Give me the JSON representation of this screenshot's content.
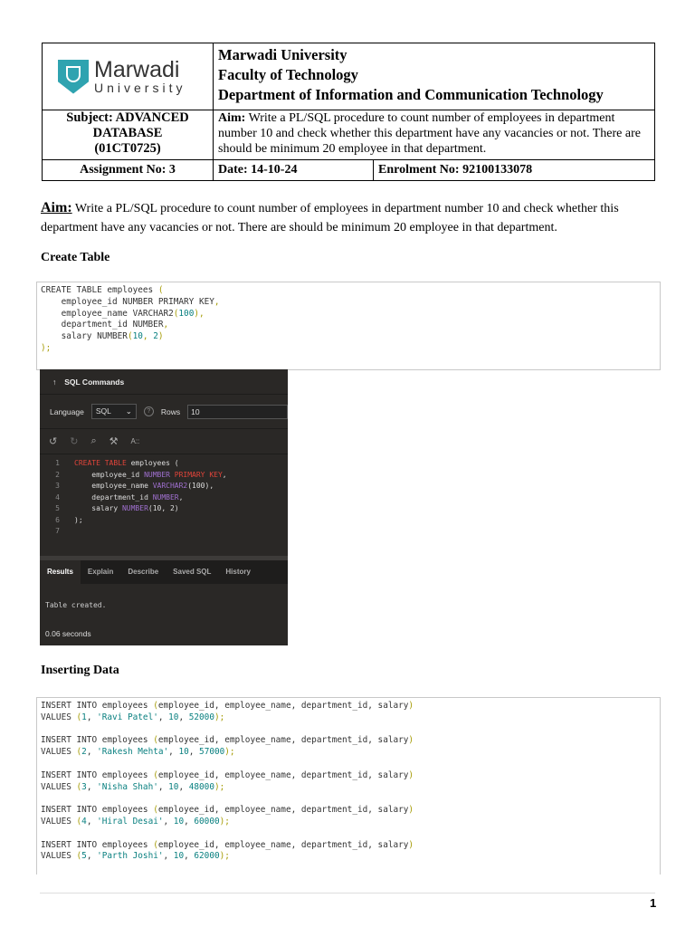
{
  "header": {
    "logo_line1": "Marwadi",
    "logo_line2": "University",
    "university": "Marwadi University",
    "faculty": "Faculty of Technology",
    "department": "Department of Information and Communication Technology",
    "subject_label": "Subject: ADVANCED DATABASE (01CT0725)",
    "aim_label": "Aim:",
    "aim_text": " Write a PL/SQL procedure  to count number of employees in department number 10 and check whether this department have any vacancies or not. There are should be minimum 20 employee in that department.",
    "assignment": "Assignment No: 3",
    "date": "Date: 14-10-24",
    "enrolment": "Enrolment No: 92100133078"
  },
  "aim": {
    "label": "Aim:",
    "text": " Write a PL/SQL procedure  to count number of employees in department number 10 and check whether this department have any vacancies or not. There are should be minimum 20 employee in that department."
  },
  "create_heading": "Create Table",
  "create_code": [
    [
      [
        "CREATE TABLE employees ",
        ""
      ],
      [
        "(",
        "p"
      ]
    ],
    [
      [
        "    employee_id NUMBER PRIMARY KEY",
        ""
      ],
      [
        ",",
        "p"
      ]
    ],
    [
      [
        "    employee_name VARCHAR2",
        ""
      ],
      [
        "(",
        "p"
      ],
      [
        "100",
        "n"
      ],
      [
        "),",
        "p"
      ]
    ],
    [
      [
        "    department_id NUMBER",
        ""
      ],
      [
        ",",
        "p"
      ]
    ],
    [
      [
        "    salary NUMBER",
        ""
      ],
      [
        "(",
        "p"
      ],
      [
        "10",
        "n"
      ],
      [
        ", ",
        "p"
      ],
      [
        "2",
        "n"
      ],
      [
        ")",
        "p"
      ]
    ],
    [
      [
        ");",
        "p"
      ]
    ]
  ],
  "sql_screen": {
    "title": "SQL Commands",
    "language_label": "Language",
    "language_value": "SQL",
    "rows_label": "Rows",
    "rows_value": "10",
    "lines": [
      [
        [
          "CREATE TABLE",
          "kr"
        ],
        [
          " employees (",
          ""
        ]
      ],
      [
        [
          "    employee_id ",
          ""
        ],
        [
          "NUMBER",
          "kp"
        ],
        [
          " PRIMARY KEY",
          "kr"
        ],
        [
          ",",
          ""
        ]
      ],
      [
        [
          "    employee_name ",
          ""
        ],
        [
          "VARCHAR2",
          "kp"
        ],
        [
          "(100),",
          ""
        ]
      ],
      [
        [
          "    department_id ",
          ""
        ],
        [
          "NUMBER",
          "kp"
        ],
        [
          ",",
          ""
        ]
      ],
      [
        [
          "    salary ",
          ""
        ],
        [
          "NUMBER",
          "kp"
        ],
        [
          "(10, 2)",
          ""
        ]
      ],
      [
        [
          ");",
          ""
        ]
      ],
      [
        [
          "",
          ""
        ]
      ]
    ],
    "tabs": [
      "Results",
      "Explain",
      "Describe",
      "Saved SQL",
      "History"
    ],
    "result": "Table created.",
    "time": "0.06 seconds"
  },
  "insert_heading": "Inserting Data",
  "insert_code": [
    [
      [
        "INSERT INTO employees ",
        ""
      ],
      [
        "(",
        "p"
      ],
      [
        "employee_id, employee_name, department_id, salary",
        ""
      ],
      [
        ")",
        "p"
      ]
    ],
    [
      [
        "VALUES ",
        ""
      ],
      [
        "(",
        "p"
      ],
      [
        "1",
        "n"
      ],
      [
        ", ",
        ""
      ],
      [
        "'Ravi Patel'",
        "s"
      ],
      [
        ", ",
        ""
      ],
      [
        "10",
        "n"
      ],
      [
        ", ",
        ""
      ],
      [
        "52000",
        "n"
      ],
      [
        ");",
        "p"
      ]
    ],
    [
      [
        "",
        ""
      ]
    ],
    [
      [
        "INSERT INTO employees ",
        ""
      ],
      [
        "(",
        "p"
      ],
      [
        "employee_id, employee_name, department_id, salary",
        ""
      ],
      [
        ")",
        "p"
      ]
    ],
    [
      [
        "VALUES ",
        ""
      ],
      [
        "(",
        "p"
      ],
      [
        "2",
        "n"
      ],
      [
        ", ",
        ""
      ],
      [
        "'Rakesh Mehta'",
        "s"
      ],
      [
        ", ",
        ""
      ],
      [
        "10",
        "n"
      ],
      [
        ", ",
        ""
      ],
      [
        "57000",
        "n"
      ],
      [
        ");",
        "p"
      ]
    ],
    [
      [
        "",
        ""
      ]
    ],
    [
      [
        "INSERT INTO employees ",
        ""
      ],
      [
        "(",
        "p"
      ],
      [
        "employee_id, employee_name, department_id, salary",
        ""
      ],
      [
        ")",
        "p"
      ]
    ],
    [
      [
        "VALUES ",
        ""
      ],
      [
        "(",
        "p"
      ],
      [
        "3",
        "n"
      ],
      [
        ", ",
        ""
      ],
      [
        "'Nisha Shah'",
        "s"
      ],
      [
        ", ",
        ""
      ],
      [
        "10",
        "n"
      ],
      [
        ", ",
        ""
      ],
      [
        "48000",
        "n"
      ],
      [
        ");",
        "p"
      ]
    ],
    [
      [
        "",
        ""
      ]
    ],
    [
      [
        "INSERT INTO employees ",
        ""
      ],
      [
        "(",
        "p"
      ],
      [
        "employee_id, employee_name, department_id, salary",
        ""
      ],
      [
        ")",
        "p"
      ]
    ],
    [
      [
        "VALUES ",
        ""
      ],
      [
        "(",
        "p"
      ],
      [
        "4",
        "n"
      ],
      [
        ", ",
        ""
      ],
      [
        "'Hiral Desai'",
        "s"
      ],
      [
        ", ",
        ""
      ],
      [
        "10",
        "n"
      ],
      [
        ", ",
        ""
      ],
      [
        "60000",
        "n"
      ],
      [
        ");",
        "p"
      ]
    ],
    [
      [
        "",
        ""
      ]
    ],
    [
      [
        "INSERT INTO employees ",
        ""
      ],
      [
        "(",
        "p"
      ],
      [
        "employee_id, employee_name, department_id, salary",
        ""
      ],
      [
        ")",
        "p"
      ]
    ],
    [
      [
        "VALUES ",
        ""
      ],
      [
        "(",
        "p"
      ],
      [
        "5",
        "n"
      ],
      [
        ", ",
        ""
      ],
      [
        "'Parth Joshi'",
        "s"
      ],
      [
        ", ",
        ""
      ],
      [
        "10",
        "n"
      ],
      [
        ", ",
        ""
      ],
      [
        "62000",
        "n"
      ],
      [
        ");",
        "p"
      ]
    ]
  ],
  "page_number": "1"
}
